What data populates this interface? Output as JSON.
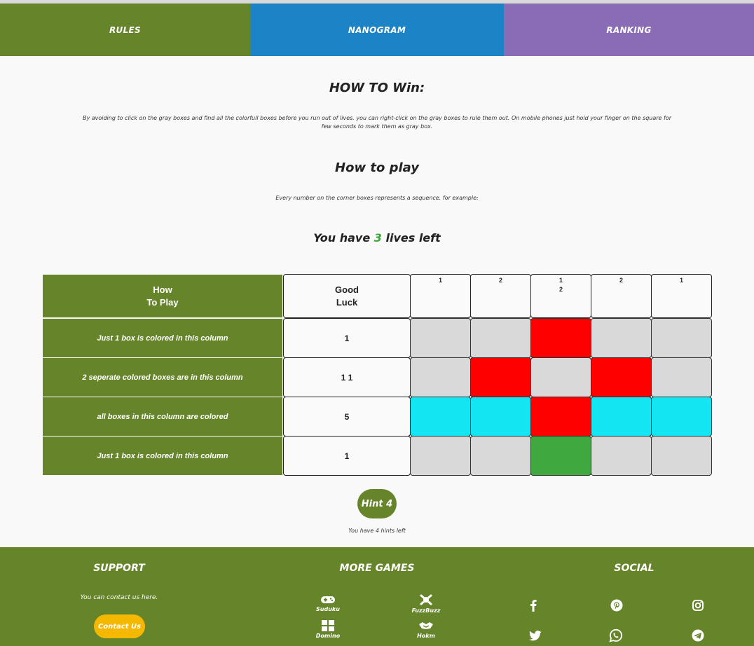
{
  "nav": {
    "rules": "RULES",
    "nanogram": "NANOGRAM",
    "ranking": "RANKING"
  },
  "win": {
    "title": "HOW TO Win:",
    "text": "By avoiding to click on the gray boxes and find all the colorfull boxes before you run out of lives. you can right-click on the gray boxes to rule them out. On mobile phones just hold your finger on the square for few seconds to mark them as gray box."
  },
  "play": {
    "title": "How to play",
    "text": "Every number on the corner boxes represents a sequence. for example:"
  },
  "lives": {
    "prefix": "You have",
    "count": "3",
    "suffix": "lives left"
  },
  "board": {
    "header_left": "How\nTo Play",
    "header_mid": "Good\nLuck",
    "col_clues": [
      "1",
      "2",
      "1\n2",
      "2",
      "1"
    ],
    "rows": [
      {
        "desc": "Just 1 box is colored in this column",
        "clue": "1",
        "cells": [
          "gray",
          "gray",
          "red",
          "gray",
          "gray"
        ]
      },
      {
        "desc": "2 seperate colored boxes are in this column",
        "clue": "1 1",
        "cells": [
          "gray",
          "red",
          "gray",
          "red",
          "gray"
        ]
      },
      {
        "desc": "all boxes in this column are colored",
        "clue": "5",
        "cells": [
          "cyan",
          "cyan",
          "red",
          "cyan",
          "cyan"
        ]
      },
      {
        "desc": "Just 1 box is colored in this column",
        "clue": "1",
        "cells": [
          "gray",
          "gray",
          "green",
          "gray",
          "gray"
        ]
      }
    ],
    "colors": {
      "gray": "#d9d9d9",
      "red": "#ff0000",
      "cyan": "#13e6f2",
      "green": "#3fa83f"
    }
  },
  "hint": {
    "button": "Hint 4",
    "text": "You have 4 hints left"
  },
  "footer": {
    "support": {
      "title": "SUPPORT",
      "text": "You can contact us here.",
      "button": "Contact Us"
    },
    "games": {
      "title": "MORE GAMES",
      "items": [
        {
          "label": "Suduku",
          "icon": "gamepad-icon"
        },
        {
          "label": "FuzzBuzz",
          "icon": "link-icon"
        },
        {
          "label": "Domino",
          "icon": "windows-icon"
        },
        {
          "label": "Hokm",
          "icon": "handshake-icon"
        }
      ]
    },
    "social": {
      "title": "SOCIAL",
      "icons": [
        "facebook-icon",
        "pinterest-icon",
        "instagram-icon",
        "twitter-icon",
        "whatsapp-icon",
        "telegram-icon"
      ]
    }
  }
}
